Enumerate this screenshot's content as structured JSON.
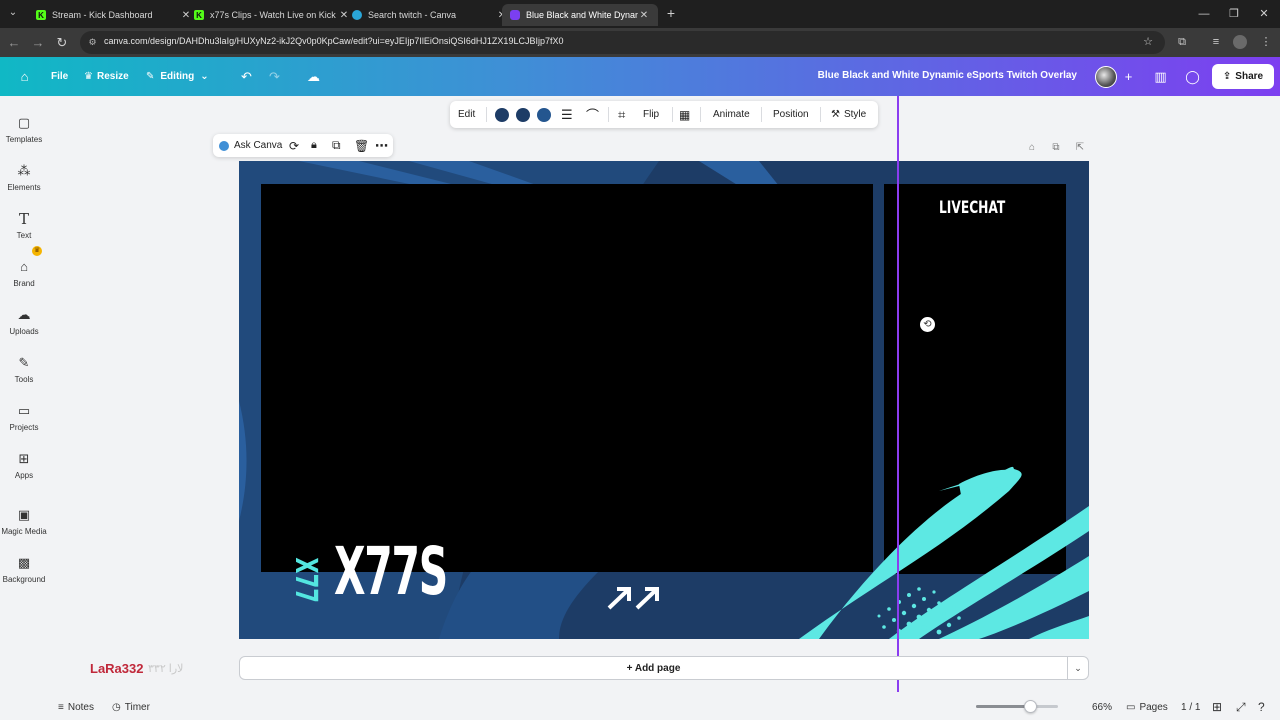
{
  "browser": {
    "tabs": [
      {
        "title": "Stream - Kick Dashboard",
        "icon": "kick-icon",
        "active": false
      },
      {
        "title": "x77s Clips - Watch Live on Kick",
        "icon": "kick-icon",
        "active": false
      },
      {
        "title": "Search twitch - Canva",
        "icon": "canva-icon",
        "active": false
      },
      {
        "title": "Blue Black and White Dynamic",
        "icon": "canva-icon",
        "active": true
      }
    ],
    "url": "canva.com/design/DAHDhu3laIg/HUXyNz2-ikJ2Qv0p0KpCaw/edit?ui=eyJEIjp7IlEiOnsiQSI6dHJ1ZX19LCJBIjp7fX0"
  },
  "header": {
    "file_label": "File",
    "resize_label": "Resize",
    "editing_label": "Editing",
    "design_title": "Blue Black and White Dynamic eSports Twitch Overlay",
    "share_label": "Share",
    "colors": {
      "gradient_start": "#10b8c5",
      "gradient_end": "#7d3ff0"
    }
  },
  "sidebar": {
    "items": [
      {
        "label": "Templates",
        "icon": "templates-icon"
      },
      {
        "label": "Elements",
        "icon": "elements-icon"
      },
      {
        "label": "Text",
        "icon": "text-icon"
      },
      {
        "label": "Brand",
        "icon": "brand-icon"
      },
      {
        "label": "Uploads",
        "icon": "uploads-icon"
      },
      {
        "label": "Tools",
        "icon": "tools-icon"
      },
      {
        "label": "Projects",
        "icon": "projects-icon"
      },
      {
        "label": "Apps",
        "icon": "apps-icon"
      },
      {
        "label": "Magic Media",
        "icon": "magic-media-icon"
      },
      {
        "label": "Background",
        "icon": "background-icon"
      }
    ]
  },
  "context_toolbar": {
    "edit_label": "Edit",
    "swatches": [
      "#1d3c66",
      "#1d3c66",
      "#24568f"
    ],
    "flip_label": "Flip",
    "animate_label": "Animate",
    "position_label": "Position",
    "style_label": "Style"
  },
  "selection_toolbar": {
    "ask_canva_label": "Ask Canva"
  },
  "canvas": {
    "livechat_text": "LIVECHAT",
    "brand_name": "X77S",
    "brand_vertical": "X77",
    "colors": {
      "background": "#1d3c66",
      "accent": "#5de8e3",
      "panel": "#000000"
    }
  },
  "add_page_label": "+ Add page",
  "watermark": {
    "name": "LaRa332",
    "arabic": "لارا ٣٣٢"
  },
  "footer": {
    "notes_label": "Notes",
    "timer_label": "Timer",
    "zoom": "66%",
    "zoom_fraction": 0.66,
    "pages_label": "Pages",
    "page_count": "1 / 1"
  }
}
